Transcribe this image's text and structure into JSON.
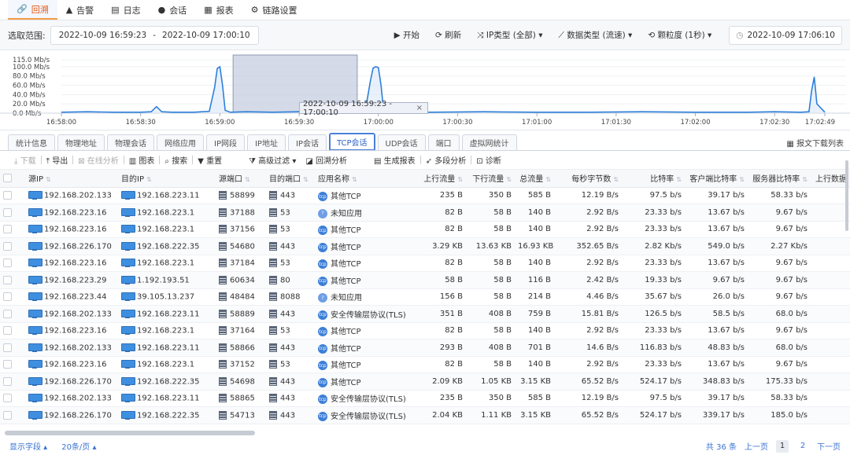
{
  "nav": {
    "items": [
      {
        "icon": "🔗",
        "label": "回溯",
        "active": true
      },
      {
        "icon": "▲",
        "label": "告警"
      },
      {
        "icon": "▤",
        "label": "日志"
      },
      {
        "icon": "●",
        "label": "会话"
      },
      {
        "icon": "▦",
        "label": "报表"
      },
      {
        "icon": "⚙",
        "label": "链路设置"
      }
    ]
  },
  "toolbar": {
    "range_label": "选取范围:",
    "range_start": "2022-10-09 16:59:23",
    "range_sep": "-",
    "range_end": "2022-10-09 17:00:10",
    "start": "▶ 开始",
    "refresh": "⟳ 刷新",
    "ip_type": "⤨ IP类型 (全部) ▾",
    "data_type": "⟋ 数据类型 (流速) ▾",
    "granularity": "⟲ 颗粒度 (1秒) ▾",
    "current_time": "2022-10-09 17:06:10"
  },
  "chart": {
    "selection_label": "2022-10-09 16:59:23 - 17:00:10",
    "close": "×"
  },
  "chart_data": {
    "type": "area",
    "y_ticks": [
      "115.0 Mb/s",
      "100.0 Mb/s",
      "80.0 Mb/s",
      "60.0 Mb/s",
      "40.0 Mb/s",
      "20.0 Mb/s",
      "0.0 Mb/s"
    ],
    "y_values": [
      115,
      100,
      80,
      60,
      40,
      20,
      0
    ],
    "ylim": [
      0,
      115
    ],
    "x_ticks": [
      "16:58:00",
      "16:58:30",
      "16:59:00",
      "16:59:30",
      "17:00:00",
      "17:00:30",
      "17:01:00",
      "17:01:30",
      "17:02:00",
      "17:02:30",
      "17:02:49"
    ],
    "x_seconds": [
      0,
      30,
      60,
      90,
      120,
      150,
      180,
      210,
      240,
      270,
      289
    ],
    "series": [
      {
        "x": [
          0,
          10,
          20,
          30,
          34,
          36,
          38,
          42,
          50,
          56,
          58,
          59,
          60,
          61,
          62,
          64,
          70,
          80,
          90,
          94,
          98,
          110,
          115,
          117,
          118,
          119,
          120,
          121,
          122,
          125,
          140,
          160,
          180,
          200,
          220,
          240,
          260,
          270,
          280,
          283,
          284,
          285,
          286,
          289
        ],
        "y": [
          2,
          3,
          2,
          2,
          3,
          14,
          3,
          2,
          2,
          4,
          55,
          96,
          100,
          60,
          6,
          2,
          3,
          2,
          3,
          12,
          3,
          2,
          4,
          70,
          97,
          100,
          98,
          60,
          5,
          2,
          2,
          3,
          2,
          2,
          3,
          2,
          2,
          3,
          2,
          3,
          48,
          78,
          20,
          2
        ]
      }
    ]
  },
  "tabs": [
    "统计信息",
    "物理地址",
    "物理会话",
    "网络应用",
    "IP网段",
    "IP地址",
    "IP会话",
    "TCP会话",
    "UDP会话",
    "端口",
    "虚拟网统计"
  ],
  "active_tab": "TCP会话",
  "tab_right": "▦ 报文下载列表",
  "actions": {
    "download": "⤓ 下载",
    "export": "⤒ 导出",
    "online": "⊠ 在线分析",
    "chart": "▥ 图表",
    "search": "⌕ 搜索",
    "reset": "▼ 重置",
    "filter": "⧩ 高级过滤 ▾",
    "backtrack": "◪ 回溯分析",
    "report": "▤ 生成报表",
    "multi": "➶ 多段分析",
    "diagnose": "⊡ 诊断"
  },
  "table": {
    "headers": [
      "源IP",
      "目的IP",
      "源端口",
      "目的端口",
      "应用名称",
      "上行流量",
      "下行流量",
      "总流量",
      "每秒字节数",
      "比特率",
      "客户端比特率",
      "服务器比特率",
      "上行数据"
    ],
    "rows": [
      [
        "192.168.202.133",
        "192.168.223.11",
        "58899",
        "443",
        "其他TCP",
        "235 B",
        "350 B",
        "585 B",
        "12.19 B/s",
        "97.5 b/s",
        "39.17 b/s",
        "58.33 b/s",
        "tcp"
      ],
      [
        "192.168.223.16",
        "192.168.223.1",
        "37188",
        "53",
        "未知应用",
        "82 B",
        "58 B",
        "140 B",
        "2.92 B/s",
        "23.33 b/s",
        "13.67 b/s",
        "9.67 b/s",
        "unk"
      ],
      [
        "192.168.223.16",
        "192.168.223.1",
        "37156",
        "53",
        "其他TCP",
        "82 B",
        "58 B",
        "140 B",
        "2.92 B/s",
        "23.33 b/s",
        "13.67 b/s",
        "9.67 b/s",
        "tcp"
      ],
      [
        "192.168.226.170",
        "192.168.222.35",
        "54680",
        "443",
        "其他TCP",
        "3.29 KB",
        "13.63 KB",
        "16.93 KB",
        "352.65 B/s",
        "2.82 Kb/s",
        "549.0 b/s",
        "2.27 Kb/s",
        "tcp"
      ],
      [
        "192.168.223.16",
        "192.168.223.1",
        "37184",
        "53",
        "其他TCP",
        "82 B",
        "58 B",
        "140 B",
        "2.92 B/s",
        "23.33 b/s",
        "13.67 b/s",
        "9.67 b/s",
        "tcp"
      ],
      [
        "192.168.223.29",
        "1.192.193.51",
        "60634",
        "80",
        "其他TCP",
        "58 B",
        "58 B",
        "116 B",
        "2.42 B/s",
        "19.33 b/s",
        "9.67 b/s",
        "9.67 b/s",
        "tcp"
      ],
      [
        "192.168.223.44",
        "39.105.13.237",
        "48484",
        "8088",
        "未知应用",
        "156 B",
        "58 B",
        "214 B",
        "4.46 B/s",
        "35.67 b/s",
        "26.0 b/s",
        "9.67 b/s",
        "unk"
      ],
      [
        "192.168.202.133",
        "192.168.223.11",
        "58889",
        "443",
        "安全传输层协议(TLS)",
        "351 B",
        "408 B",
        "759 B",
        "15.81 B/s",
        "126.5 b/s",
        "58.5 b/s",
        "68.0 b/s",
        "tcp"
      ],
      [
        "192.168.223.16",
        "192.168.223.1",
        "37164",
        "53",
        "其他TCP",
        "82 B",
        "58 B",
        "140 B",
        "2.92 B/s",
        "23.33 b/s",
        "13.67 b/s",
        "9.67 b/s",
        "tcp"
      ],
      [
        "192.168.202.133",
        "192.168.223.11",
        "58866",
        "443",
        "其他TCP",
        "293 B",
        "408 B",
        "701 B",
        "14.6 B/s",
        "116.83 b/s",
        "48.83 b/s",
        "68.0 b/s",
        "tcp"
      ],
      [
        "192.168.223.16",
        "192.168.223.1",
        "37152",
        "53",
        "其他TCP",
        "82 B",
        "58 B",
        "140 B",
        "2.92 B/s",
        "23.33 b/s",
        "13.67 b/s",
        "9.67 b/s",
        "tcp"
      ],
      [
        "192.168.226.170",
        "192.168.222.35",
        "54698",
        "443",
        "其他TCP",
        "2.09 KB",
        "1.05 KB",
        "3.15 KB",
        "65.52 B/s",
        "524.17 b/s",
        "348.83 b/s",
        "175.33 b/s",
        "tcp"
      ],
      [
        "192.168.202.133",
        "192.168.223.11",
        "58865",
        "443",
        "安全传输层协议(TLS)",
        "235 B",
        "350 B",
        "585 B",
        "12.19 B/s",
        "97.5 b/s",
        "39.17 b/s",
        "58.33 b/s",
        "tcp"
      ],
      [
        "192.168.226.170",
        "192.168.222.35",
        "54713",
        "443",
        "安全传输层协议(TLS)",
        "2.04 KB",
        "1.11 KB",
        "3.15 KB",
        "65.52 B/s",
        "524.17 b/s",
        "339.17 b/s",
        "185.0 b/s",
        "tcp"
      ]
    ]
  },
  "footer": {
    "fields": "显示字段 ▴",
    "page_size": "20条/页 ▴",
    "total": "共 36 条",
    "prev": "上一页",
    "page1": "1",
    "page2": "2",
    "next": "下一页"
  },
  "colors": {
    "accent": "#e15a17",
    "link": "#3a72d2",
    "series": "#2f7fd8"
  }
}
